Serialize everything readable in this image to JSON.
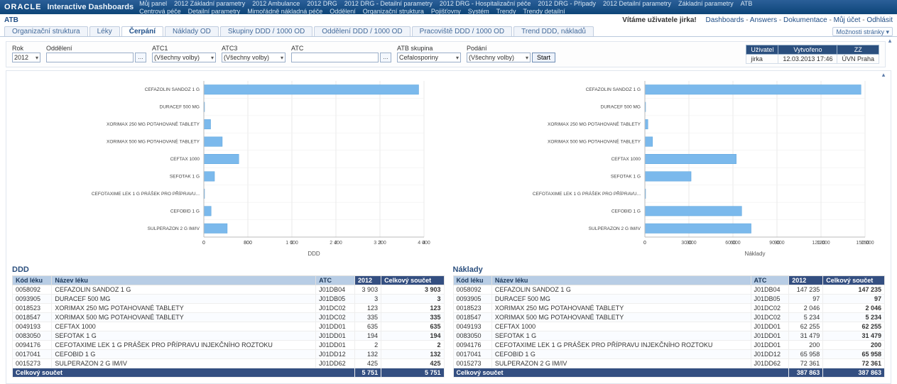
{
  "header": {
    "logo": "ORACLE",
    "product": "Interactive Dashboards"
  },
  "nav_items": [
    "Můj panel",
    "2012 Základní parametry",
    "2012 Ambulance",
    "2012 DRG",
    "2012 DRG - Detailní parametry",
    "2012 DRG - Hospitalizační péče",
    "2012 DRG - Případy",
    "2012 Detailní parametry",
    "Základní parametry",
    "ATB",
    "Centrová péče",
    "Detailní parametry",
    "Mimořádně nákladná péče",
    "Oddělení",
    "Organizační struktura",
    "Pojišťovny",
    "Systém",
    "Trendy",
    "Trendy detailní"
  ],
  "subheader": {
    "page_title": "ATB",
    "welcome": "Vítáme uživatele jirka!",
    "links": [
      "Dashboards",
      "Answers",
      "Dokumentace",
      "Můj účet",
      "Odhlásit"
    ]
  },
  "tabs": [
    "Organizační struktura",
    "Léky",
    "Čerpání",
    "Náklady OD",
    "Skupiny DDD / 1000 OD",
    "Oddělení DDD / 1000 OD",
    "Pracoviště DDD / 1000 OD",
    "Trend DDD, nákladů"
  ],
  "active_tab": 2,
  "page_options_label": "Možnosti stránky ▾",
  "filters": {
    "rok": {
      "label": "Rok",
      "value": "2012"
    },
    "oddeleni": {
      "label": "Oddělení",
      "value": ""
    },
    "atc1": {
      "label": "ATC1",
      "value": "(Všechny volby)"
    },
    "atc3": {
      "label": "ATC3",
      "value": "(Všechny volby)"
    },
    "atc": {
      "label": "ATC",
      "value": ""
    },
    "atb_skupina": {
      "label": "ATB skupina",
      "value": "Cefalosporiny"
    },
    "podani": {
      "label": "Podání",
      "value": "(Všechny volby)"
    },
    "start": "Start"
  },
  "userinfo": {
    "headers": [
      "Uživatel",
      "Vytvořeno",
      "ZZ"
    ],
    "cells": [
      "jirka",
      "12.03.2013 17:46",
      "ÚVN Praha"
    ]
  },
  "chart_data": [
    {
      "type": "bar",
      "title": "DDD",
      "orientation": "horizontal",
      "categories": [
        "CEFAZOLIN SANDOZ 1 G",
        "DURACEF 500 MG",
        "XORIMAX 250 MG POTAHOVANÉ TABLETY",
        "XORIMAX 500 MG POTAHOVANÉ TABLETY",
        "CEFTAX 1000",
        "SEFOTAK 1 G",
        "CEFOTAXIME LEK 1 G PRÁŠEK PRO PŘÍPRAVU...",
        "CEFOBID 1 G",
        "SULPERAZON 2 G IM/IV"
      ],
      "values": [
        3903,
        3,
        123,
        335,
        635,
        194,
        2,
        132,
        425
      ],
      "xlabel": "DDD",
      "xlim": [
        0,
        4000
      ],
      "xticks": [
        0,
        800,
        1600,
        2400,
        3200,
        4000
      ]
    },
    {
      "type": "bar",
      "title": "Náklady",
      "orientation": "horizontal",
      "categories": [
        "CEFAZOLIN SANDOZ 1 G",
        "DURACEF 500 MG",
        "XORIMAX 250 MG POTAHOVANÉ TABLETY",
        "XORIMAX 500 MG POTAHOVANÉ TABLETY",
        "CEFTAX 1000",
        "SEFOTAK 1 G",
        "CEFOTAXIME LEK 1 G PRÁŠEK PRO PŘÍPRAVU...",
        "CEFOBID 1 G",
        "SULPERAZON 2 G IM/IV"
      ],
      "values": [
        147235,
        97,
        2046,
        5234,
        62255,
        31479,
        200,
        65958,
        72361
      ],
      "xlabel": "Náklady",
      "xlim": [
        0,
        150000
      ],
      "xticks": [
        0,
        30000,
        60000,
        90000,
        120000,
        150000
      ]
    }
  ],
  "section_titles": {
    "left": "DDD",
    "right": "Náklady"
  },
  "table_headers": {
    "kod": "Kód léku",
    "nazev": "Název léku",
    "atc": "ATC",
    "year": "2012",
    "total": "Celkový součet"
  },
  "table_left": {
    "rows": [
      {
        "kod": "0058092",
        "nazev": "CEFAZOLIN SANDOZ 1 G",
        "atc": "J01DB04",
        "year": "3 903",
        "total": "3 903"
      },
      {
        "kod": "0093905",
        "nazev": "DURACEF 500 MG",
        "atc": "J01DB05",
        "year": "3",
        "total": "3"
      },
      {
        "kod": "0018523",
        "nazev": "XORIMAX 250 MG POTAHOVANÉ TABLETY",
        "atc": "J01DC02",
        "year": "123",
        "total": "123"
      },
      {
        "kod": "0018547",
        "nazev": "XORIMAX 500 MG POTAHOVANÉ TABLETY",
        "atc": "J01DC02",
        "year": "335",
        "total": "335"
      },
      {
        "kod": "0049193",
        "nazev": "CEFTAX 1000",
        "atc": "J01DD01",
        "year": "635",
        "total": "635"
      },
      {
        "kod": "0083050",
        "nazev": "SEFOTAK 1 G",
        "atc": "J01DD01",
        "year": "194",
        "total": "194"
      },
      {
        "kod": "0094176",
        "nazev": "CEFOTAXIME LEK 1 G PRÁŠEK PRO PŘÍPRAVU INJEKČNÍHO ROZTOKU",
        "atc": "J01DD01",
        "year": "2",
        "total": "2"
      },
      {
        "kod": "0017041",
        "nazev": "CEFOBID 1 G",
        "atc": "J01DD12",
        "year": "132",
        "total": "132"
      },
      {
        "kod": "0015273",
        "nazev": "SULPERAZON 2 G IM/IV",
        "atc": "J01DD62",
        "year": "425",
        "total": "425"
      }
    ],
    "sum_label": "Celkový součet",
    "sum_year": "5 751",
    "sum_total": "5 751"
  },
  "table_right": {
    "rows": [
      {
        "kod": "0058092",
        "nazev": "CEFAZOLIN SANDOZ 1 G",
        "atc": "J01DB04",
        "year": "147 235",
        "total": "147 235"
      },
      {
        "kod": "0093905",
        "nazev": "DURACEF 500 MG",
        "atc": "J01DB05",
        "year": "97",
        "total": "97"
      },
      {
        "kod": "0018523",
        "nazev": "XORIMAX 250 MG POTAHOVANÉ TABLETY",
        "atc": "J01DC02",
        "year": "2 046",
        "total": "2 046"
      },
      {
        "kod": "0018547",
        "nazev": "XORIMAX 500 MG POTAHOVANÉ TABLETY",
        "atc": "J01DC02",
        "year": "5 234",
        "total": "5 234"
      },
      {
        "kod": "0049193",
        "nazev": "CEFTAX 1000",
        "atc": "J01DD01",
        "year": "62 255",
        "total": "62 255"
      },
      {
        "kod": "0083050",
        "nazev": "SEFOTAK 1 G",
        "atc": "J01DD01",
        "year": "31 479",
        "total": "31 479"
      },
      {
        "kod": "0094176",
        "nazev": "CEFOTAXIME LEK 1 G PRÁŠEK PRO PŘÍPRAVU INJEKČNÍHO ROZTOKU",
        "atc": "J01DD01",
        "year": "200",
        "total": "200"
      },
      {
        "kod": "0017041",
        "nazev": "CEFOBID 1 G",
        "atc": "J01DD12",
        "year": "65 958",
        "total": "65 958"
      },
      {
        "kod": "0015273",
        "nazev": "SULPERAZON 2 G IM/IV",
        "atc": "J01DD62",
        "year": "72 361",
        "total": "72 361"
      }
    ],
    "sum_label": "Celkový součet",
    "sum_year": "387 863",
    "sum_total": "387 863"
  }
}
